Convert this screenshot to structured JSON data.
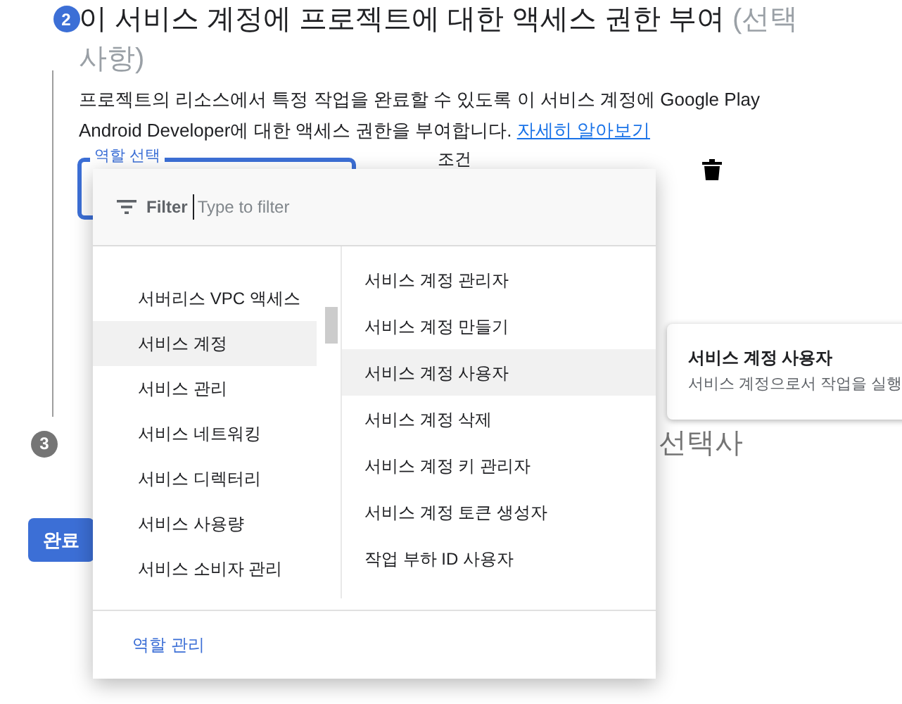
{
  "step2": {
    "number": "2",
    "title": "이 서비스 계정에 프로젝트에 대한 액세스 권한 부여",
    "title_note": "(선택사항)",
    "description": "프로젝트의 리소스에서 특정 작업을 완료할 수 있도록 이 서비스 계정에 Google Play Android Developer에 대한 액세스 권한을 부여합니다.",
    "learn_more": "자세히 알아보기"
  },
  "role_field": {
    "label": "역할 선택"
  },
  "condition_label": "조건",
  "step3": {
    "number": "3",
    "title_fragment": "선택사"
  },
  "done_button": "완료",
  "role_menu": {
    "filter_label": "Filter",
    "placeholder": "Type to filter",
    "categories": [
      {
        "label": "서버리스 VPC 액세스",
        "selected": false
      },
      {
        "label": "서비스 계정",
        "selected": true
      },
      {
        "label": "서비스 관리",
        "selected": false
      },
      {
        "label": "서비스 네트워킹",
        "selected": false
      },
      {
        "label": "서비스 디렉터리",
        "selected": false
      },
      {
        "label": "서비스 사용량",
        "selected": false
      },
      {
        "label": "서비스 소비자 관리",
        "selected": false
      }
    ],
    "roles": [
      {
        "label": "서비스 계정 관리자",
        "selected": false
      },
      {
        "label": "서비스 계정 만들기",
        "selected": false
      },
      {
        "label": "서비스 계정 사용자",
        "selected": true
      },
      {
        "label": "서비스 계정 삭제",
        "selected": false
      },
      {
        "label": "서비스 계정 키 관리자",
        "selected": false
      },
      {
        "label": "서비스 계정 토큰 생성자",
        "selected": false
      },
      {
        "label": "작업 부하 ID 사용자",
        "selected": false
      }
    ],
    "manage_link": "역할 관리"
  },
  "role_tooltip": {
    "title": "서비스 계정 사용자",
    "description": "서비스 계정으로서 작업을 실행"
  }
}
